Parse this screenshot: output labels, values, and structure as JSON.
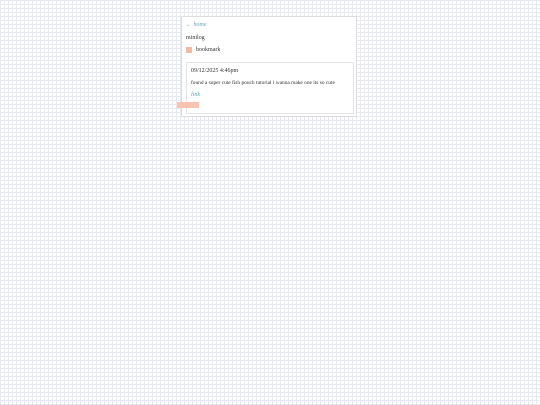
{
  "nav": {
    "back_arrow": "←",
    "back_label": "home"
  },
  "app": {
    "title": "minilog"
  },
  "bookmark": {
    "label": "bookmark",
    "swatch_color": "#f4b99e"
  },
  "post": {
    "timestamp": "09/12/2025 4:46pm",
    "text": "found a super cute fish pouch tutorial i wanna make one its so cute",
    "link_label": "link"
  },
  "colors": {
    "link": "#5aa6bf",
    "accent": "#f8c4b0"
  }
}
